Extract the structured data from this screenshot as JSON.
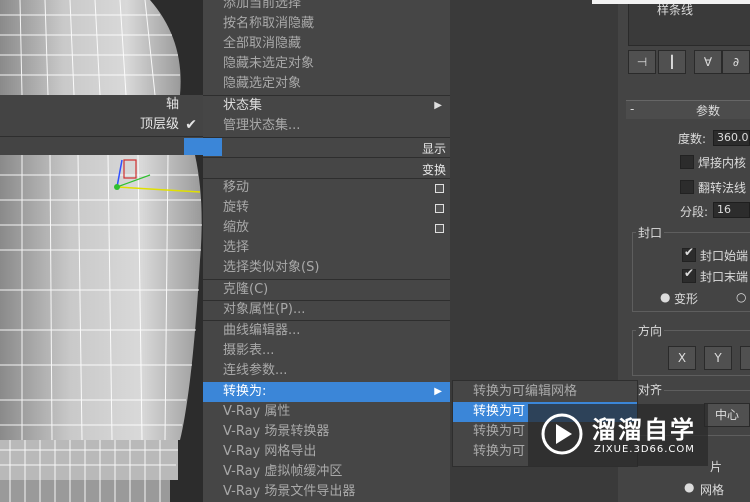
{
  "quad_left": {
    "axis_label": "轴",
    "top_level_label": "顶层级",
    "top_level_check": "✔"
  },
  "quad_middle": {
    "top_items": [
      "添加当前选择",
      "按名称取消隐藏",
      "全部取消隐藏",
      "隐藏未选定对象",
      "隐藏选定对象"
    ],
    "state_set": "状态集",
    "manage_state_set": "管理状态集...",
    "header_display": "显示",
    "header_transform": "变换",
    "move": "移动",
    "rotate": "旋转",
    "scale": "缩放",
    "select": "选择",
    "select_similar": "选择类似对象(S)",
    "clone": "克隆(C)",
    "object_properties": "对象属性(P)...",
    "curve_editor": "曲线编辑器...",
    "dope_sheet": "摄影表...",
    "wire_params": "连线参数...",
    "convert_to": "转换为:",
    "vray_props": "V-Ray 属性",
    "vray_scene_converter": "V-Ray 场景转换器",
    "vray_mesh_export": "V-Ray 网格导出",
    "vray_vfb": "V-Ray 虚拟帧缓冲区",
    "vray_scene_export": "V-Ray 场景文件导出器"
  },
  "submenu": {
    "items": [
      "转换为可编辑网格",
      "转换为可",
      "转换为可",
      "转换为可"
    ]
  },
  "panel": {
    "spline_label": "样条线",
    "params_title": "参数",
    "degree_label": "度数:",
    "degree_value": "360.0",
    "weld_core": "焊接内核",
    "flip_normals": "翻转法线",
    "segments_label": "分段:",
    "segments_value": "16",
    "cap_title": "封口",
    "cap_start": "封口始端",
    "cap_end": "封口末端",
    "morph": "变形",
    "direction_title": "方向",
    "x": "X",
    "y": "Y",
    "align_title": "对齐",
    "center": "中心",
    "output_partial": "片",
    "mesh": "网格"
  },
  "watermark": {
    "title": "溜溜自学",
    "url": "ZIXUE.3D66.COM"
  },
  "colors": {
    "highlight": "#3b86d8",
    "menu_bg": "#464646"
  }
}
